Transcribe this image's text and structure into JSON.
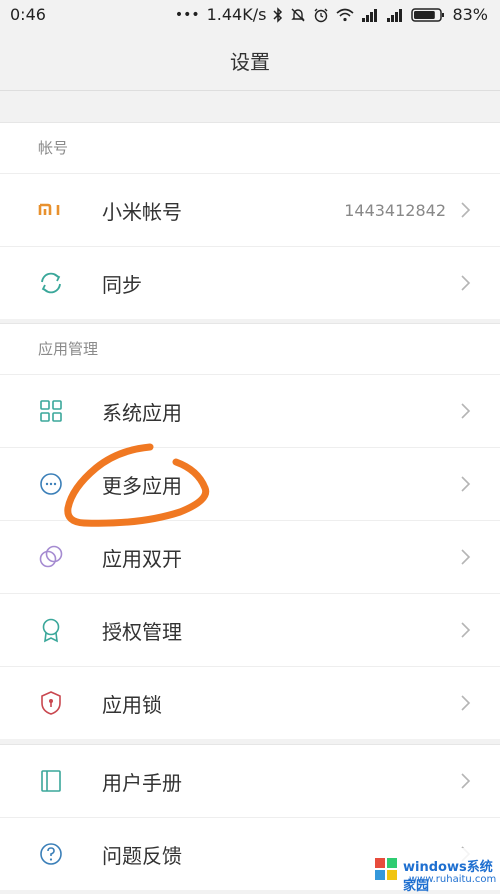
{
  "status_bar": {
    "time": "0:46",
    "dots": "•••",
    "speed": "1.44K/s",
    "battery": "83%",
    "icons": [
      "bluetooth-icon",
      "mute-bell-icon",
      "alarm-icon",
      "wifi-icon",
      "signal-icon",
      "signal-icon",
      "battery-icon"
    ],
    "battery_level": 0.83
  },
  "header": {
    "title": "设置"
  },
  "sections": [
    {
      "header": "帐号",
      "rows": [
        {
          "label": "小米帐号",
          "value": "1443412842",
          "icon": "mi-logo-icon"
        },
        {
          "label": "同步",
          "icon": "sync-icon"
        }
      ]
    },
    {
      "header": "应用管理",
      "rows": [
        {
          "label": "系统应用",
          "icon": "grid-apps-icon"
        },
        {
          "label": "更多应用",
          "icon": "more-circle-icon"
        },
        {
          "label": "应用双开",
          "icon": "dual-app-icon"
        },
        {
          "label": "授权管理",
          "icon": "permission-badge-icon"
        },
        {
          "label": "应用锁",
          "icon": "shield-lock-icon"
        }
      ]
    },
    {
      "header": "",
      "rows": [
        {
          "label": "用户手册",
          "icon": "manual-book-icon"
        },
        {
          "label": "问题反馈",
          "icon": "help-circle-icon"
        }
      ]
    }
  ],
  "colors": {
    "mi_orange": "#e8912e",
    "teal": "#3aa79a",
    "purple": "#a58bd1",
    "red": "#c9474f",
    "annotation": "#f07822"
  },
  "watermark": {
    "text": "windows系统家园",
    "sub": "www.ruhaitu.com"
  }
}
